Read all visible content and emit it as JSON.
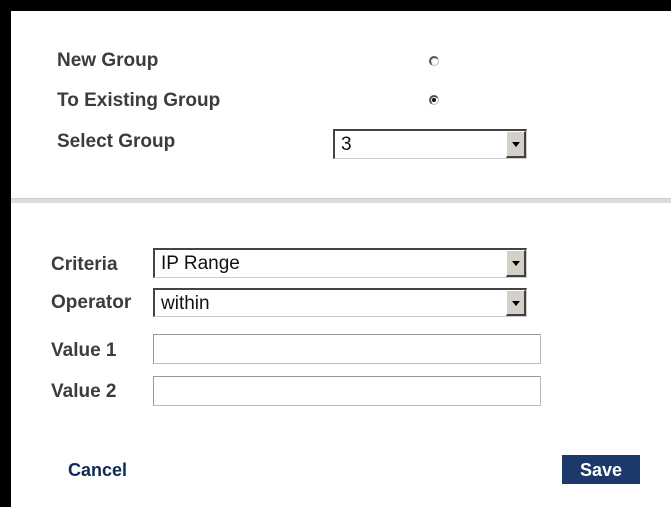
{
  "group": {
    "new_group_label": "New Group",
    "existing_group_label": "To Existing Group",
    "select_group_label": "Select Group",
    "selected_option": "to_existing_group",
    "select_group_value": "3"
  },
  "rule": {
    "criteria_label": "Criteria",
    "criteria_value": "IP Range",
    "operator_label": "Operator",
    "operator_value": "within",
    "value1_label": "Value 1",
    "value1_value": "",
    "value2_label": "Value 2",
    "value2_value": ""
  },
  "actions": {
    "cancel_label": "Cancel",
    "save_label": "Save"
  },
  "icons": {
    "dropdown": "chevron-down-icon",
    "radio": "radio-button-icon"
  },
  "colors": {
    "save_button_bg": "#1b3a6b",
    "cancel_link": "#0d2a55",
    "label_text": "#3c3c3c"
  }
}
